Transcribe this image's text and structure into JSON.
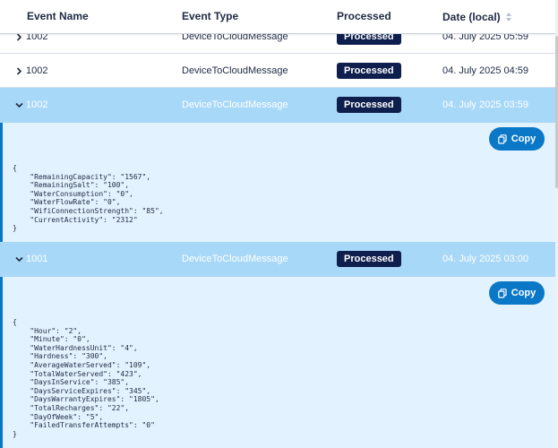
{
  "columns": {
    "event_name": "Event Name",
    "event_type": "Event Type",
    "processed": "Processed",
    "date": "Date (local)"
  },
  "rows": [
    {
      "event_name": "1002",
      "event_type": "DeviceToCloudMessage",
      "processed": "Processed",
      "date": "04. July 2025 05:59"
    },
    {
      "event_name": "1002",
      "event_type": "DeviceToCloudMessage",
      "processed": "Processed",
      "date": "04. July 2025 04:59"
    },
    {
      "event_name": "1002",
      "event_type": "DeviceToCloudMessage",
      "processed": "Processed",
      "date": "04. July 2025 03:59"
    },
    {
      "event_name": "1001",
      "event_type": "DeviceToCloudMessage",
      "processed": "Processed",
      "date": "04. July 2025 03:00"
    }
  ],
  "details": [
    {
      "copy_label": "Copy",
      "json": "{\n    \"RemainingCapacity\": \"1567\",\n    \"RemainingSalt\": \"100\",\n    \"WaterConsumption\": \"0\",\n    \"WaterFlowRate\": \"0\",\n    \"WifiConnectionStrength\": \"85\",\n    \"CurrentActivity\": \"2312\"\n}"
    },
    {
      "copy_label": "Copy",
      "json": "{\n    \"Hour\": \"2\",\n    \"Minute\": \"0\",\n    \"WaterHardnessUnit\": \"4\",\n    \"Hardness\": \"300\",\n    \"AverageWaterServed\": \"109\",\n    \"TotalWaterServed\": \"423\",\n    \"DaysInService\": \"385\",\n    \"DaysServiceExpires\": \"345\",\n    \"DaysWarrantyExpires\": \"1805\",\n    \"TotalRecharges\": \"22\",\n    \"DayOfWeek\": \"5\",\n    \"FailedTransferAttempts\": \"0\"\n}"
    }
  ],
  "icons": {
    "collapsed": "chevron-right-icon",
    "expanded": "chevron-down-icon",
    "sort": "sort-icon",
    "copy": "copy-icon"
  },
  "colors": {
    "expanded_row": "#a8d8f8",
    "detail_bg": "#e3f2ff",
    "accent": "#0a78c7",
    "badge": "#0f1f4d"
  }
}
